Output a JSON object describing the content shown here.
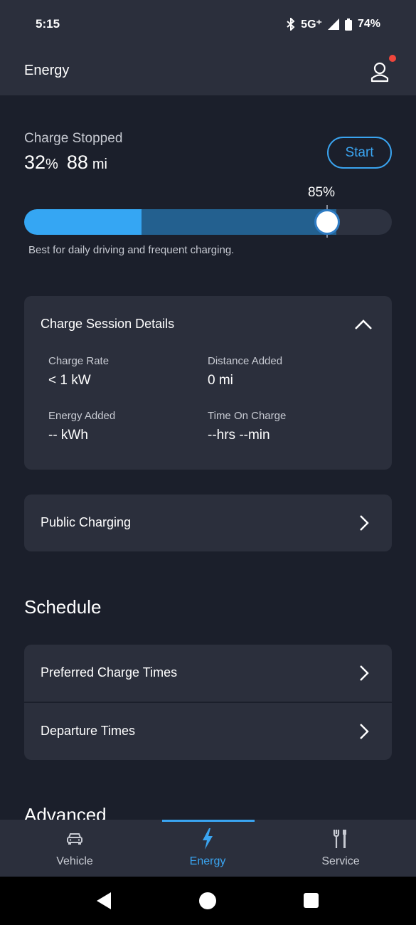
{
  "status_bar": {
    "time": "5:15",
    "network": "5G⁺",
    "battery": "74%",
    "battery_level": 0.74
  },
  "header": {
    "title": "Energy",
    "has_notification": true
  },
  "charge": {
    "status": "Charge Stopped",
    "percent_value": "32",
    "percent_unit": "%",
    "range_value": "88",
    "range_unit": "mi",
    "start_label": "Start",
    "current_level_percent": 32,
    "limit_label": "85%",
    "limit_percent": 85,
    "caption": "Best for daily driving and frequent charging."
  },
  "details": {
    "title": "Charge Session Details",
    "items": [
      {
        "label": "Charge Rate",
        "value": "< 1 kW"
      },
      {
        "label": "Distance Added",
        "value": "0 mi"
      },
      {
        "label": "Energy Added",
        "value": "-- kWh"
      },
      {
        "label": "Time On Charge",
        "value": "--hrs --min"
      }
    ]
  },
  "public_charging": {
    "label": "Public Charging"
  },
  "schedule": {
    "title": "Schedule",
    "items": [
      {
        "label": "Preferred Charge Times"
      },
      {
        "label": "Departure Times"
      }
    ]
  },
  "advanced": {
    "title": "Advanced"
  },
  "bottom_nav": {
    "items": [
      {
        "label": "Vehicle",
        "icon": "car-icon"
      },
      {
        "label": "Energy",
        "icon": "lightning-icon",
        "active": true
      },
      {
        "label": "Service",
        "icon": "tools-icon"
      }
    ]
  },
  "colors": {
    "background": "#1b1f2b",
    "card": "#2b2f3c",
    "accent": "#3aa4f0",
    "notification": "#f0463c"
  }
}
